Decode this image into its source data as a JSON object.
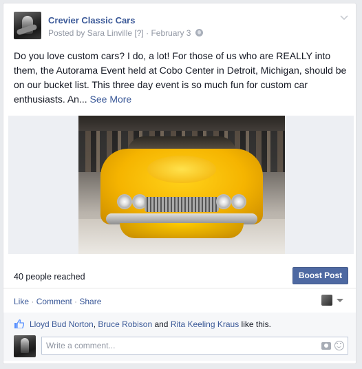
{
  "post": {
    "page_name": "Crevier Classic Cars",
    "posted_by": "Posted by Sara Linville",
    "help_marker": "[?]",
    "separator": "·",
    "date": "February 3",
    "privacy_icon": "globe-icon",
    "menu_icon": "chevron-down-icon",
    "text": "Do you love custom cars? I do, a lot! For those of us who are REALLY into them, the Autorama Event held at Cobo Center in Detroit, Michigan, should be on our bucket list. This three day event is so much fun for custom car enthusiasts. An...",
    "see_more": "See More"
  },
  "insights": {
    "reach": "40 people reached",
    "boost_label": "Boost Post",
    "boost_color": "#4e69a2"
  },
  "actions": {
    "like": "Like",
    "comment": "Comment",
    "share": "Share",
    "sep1": " · ",
    "sep2": " · "
  },
  "likes": {
    "icon": "thumbs-up-icon",
    "names": [
      "Lloyd Bud Norton",
      "Bruce Robison",
      "Rita Keeling Kraus"
    ],
    "sep": ", ",
    "and": " and ",
    "suffix": " like this."
  },
  "comment_box": {
    "placeholder": "Write a comment...",
    "camera_icon": "camera-icon",
    "emoji_icon": "smiley-icon"
  },
  "colors": {
    "link": "#3b5998",
    "meta": "#9197a3",
    "text": "#141823"
  }
}
